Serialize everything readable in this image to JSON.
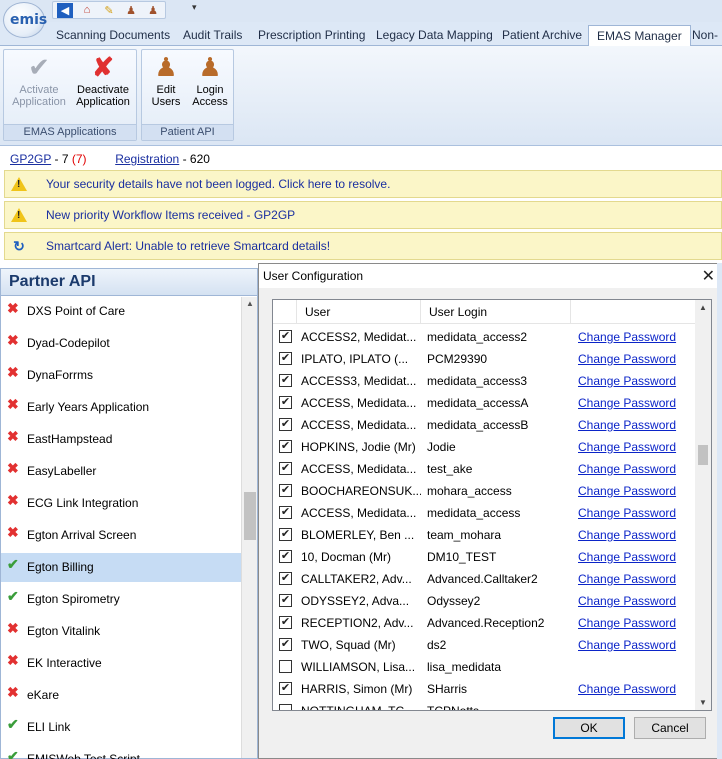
{
  "app": {
    "logo_text": "emis",
    "quick_access": [
      "back-icon",
      "home-icon",
      "pencil-icon",
      "users-icon",
      "user-group-icon"
    ],
    "tabs": [
      {
        "label": "Scanning  Documents",
        "active": false
      },
      {
        "label": "Audit Trails",
        "active": false
      },
      {
        "label": "Prescription Printing",
        "active": false
      },
      {
        "label": "Legacy Data Mapping",
        "active": false
      },
      {
        "label": "Patient Archive",
        "active": false
      },
      {
        "label": "EMAS Manager",
        "active": true
      },
      {
        "label": "Non-F",
        "active": false
      }
    ]
  },
  "ribbon": {
    "groups": [
      {
        "label": "EMAS Applications",
        "buttons": [
          {
            "label_line1": "Activate",
            "label_line2": "Application",
            "enabled": false,
            "icon": "checkmark-icon"
          },
          {
            "label_line1": "Deactivate",
            "label_line2": "Application",
            "enabled": true,
            "icon": "red-x-icon"
          }
        ]
      },
      {
        "label": "Patient API",
        "buttons": [
          {
            "label_line1": "Edit",
            "label_line2": "Users",
            "enabled": true,
            "icon": "user-edit-icon"
          },
          {
            "label_line1": "Login",
            "label_line2": "Access",
            "enabled": true,
            "icon": "user-login-icon"
          }
        ]
      }
    ]
  },
  "status_line": {
    "gp2gp_label": "GP2GP",
    "gp2gp_count": "- 7",
    "gp2gp_red": "(7)",
    "registration_label": "Registration",
    "registration_count": "- 620"
  },
  "alerts": [
    {
      "icon": "warning-icon",
      "text": "Your security details have not been logged.  Click here to resolve."
    },
    {
      "icon": "warning-icon",
      "text": "New priority Workflow Items received - GP2GP"
    },
    {
      "icon": "smartcard-alert-icon",
      "text": "Smartcard Alert:  Unable to retrieve Smartcard details!"
    }
  ],
  "partner_panel": {
    "title": "Partner API",
    "items": [
      {
        "name": "DXS Point of Care",
        "status": "x"
      },
      {
        "name": "Dyad-Codepilot",
        "status": "x"
      },
      {
        "name": "DynaForrms",
        "status": "x"
      },
      {
        "name": "Early Years Application",
        "status": "x"
      },
      {
        "name": "EastHampstead",
        "status": "x"
      },
      {
        "name": "EasyLabeller",
        "status": "x"
      },
      {
        "name": "ECG Link Integration",
        "status": "x"
      },
      {
        "name": "Egton Arrival Screen",
        "status": "x"
      },
      {
        "name": "Egton Billing",
        "status": "ok",
        "selected": true
      },
      {
        "name": "Egton Spirometry",
        "status": "ok"
      },
      {
        "name": "Egton Vitalink",
        "status": "x"
      },
      {
        "name": "EK Interactive",
        "status": "x"
      },
      {
        "name": "eKare",
        "status": "x"
      },
      {
        "name": "ELI Link",
        "status": "ok"
      },
      {
        "name": "EMISWeb Test Script",
        "status": "ok"
      }
    ]
  },
  "dialog": {
    "title": "User Configuration",
    "col_user": "User",
    "col_login": "User Login",
    "ok_label": "OK",
    "cancel_label": "Cancel",
    "rows": [
      {
        "checked": true,
        "user": "ACCESS2, Medidat...",
        "login": "medidata_access2",
        "link": "Change Password"
      },
      {
        "checked": true,
        "user": "IPLATO, IPLATO (...",
        "login": "PCM29390",
        "link": "Change Password"
      },
      {
        "checked": true,
        "user": "ACCESS3, Medidat...",
        "login": "medidata_access3",
        "link": "Change Password"
      },
      {
        "checked": true,
        "user": "ACCESS, Medidata...",
        "login": "medidata_accessA",
        "link": "Change Password"
      },
      {
        "checked": true,
        "user": "ACCESS, Medidata...",
        "login": "medidata_accessB",
        "link": "Change Password"
      },
      {
        "checked": true,
        "user": "HOPKINS, Jodie (Mr)",
        "login": "Jodie",
        "link": "Change Password"
      },
      {
        "checked": true,
        "user": "ACCESS, Medidata...",
        "login": "test_ake",
        "link": "Change Password"
      },
      {
        "checked": true,
        "user": "BOOCHAREONSUK...",
        "login": "mohara_access",
        "link": "Change Password"
      },
      {
        "checked": true,
        "user": "ACCESS, Medidata...",
        "login": "medidata_access",
        "link": "Change Password"
      },
      {
        "checked": true,
        "user": "BLOMERLEY, Ben ...",
        "login": "team_mohara",
        "link": "Change Password"
      },
      {
        "checked": true,
        "user": "10, Docman (Mr)",
        "login": "DM10_TEST",
        "link": "Change Password"
      },
      {
        "checked": true,
        "user": "CALLTAKER2, Adv...",
        "login": "Advanced.Calltaker2",
        "link": "Change Password"
      },
      {
        "checked": true,
        "user": "ODYSSEY2, Adva...",
        "login": "Odyssey2",
        "link": "Change Password"
      },
      {
        "checked": true,
        "user": "RECEPTION2, Adv...",
        "login": "Advanced.Reception2",
        "link": "Change Password"
      },
      {
        "checked": true,
        "user": "TWO, Squad (Mr)",
        "login": "ds2",
        "link": "Change Password"
      },
      {
        "checked": false,
        "user": "WILLIAMSON, Lisa...",
        "login": "lisa_medidata",
        "link": ""
      },
      {
        "checked": true,
        "user": "HARRIS, Simon (Mr)",
        "login": "SHarris",
        "link": "Change Password"
      },
      {
        "checked": false,
        "user": "NOTTINGHAM, TC...",
        "login": "TCPNotts",
        "link": ""
      }
    ]
  }
}
